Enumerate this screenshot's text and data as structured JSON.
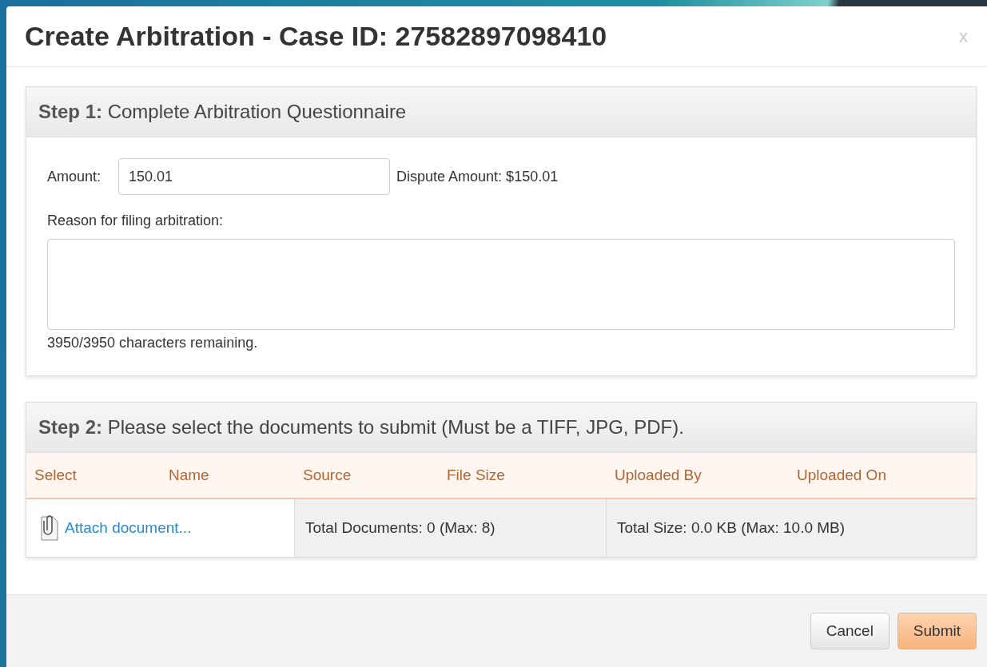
{
  "dialog": {
    "title": "Create Arbitration - Case ID: 27582897098410",
    "close": "x"
  },
  "step1": {
    "heading": "**Step 1:** Complete Arbitration Questionnaire",
    "amount_label": "Amount:",
    "amount_value": "150.01",
    "dispute_amount": "Dispute Amount: $150.01",
    "reason_label": "Reason for filing arbitration:",
    "remaining": "3950/3950 characters remaining."
  },
  "step2": {
    "heading": "**Step 2:** Please select the documents to submit (Must be a TIFF, JPG, PDF).",
    "columns": [
      "Select",
      "Name",
      "Source",
      "File Size",
      "Uploaded By",
      "Uploaded On"
    ],
    "attach_link": "Attach document...",
    "total_documents": "Total Documents: 0 (Max: 8)",
    "total_size": "Total Size: 0.0 KB (Max: 10.0 MB)"
  },
  "buttons": [
    {
      "label": "Cancel",
      "kind": "default"
    },
    {
      "label": "Submit",
      "kind": "primary"
    }
  ]
}
